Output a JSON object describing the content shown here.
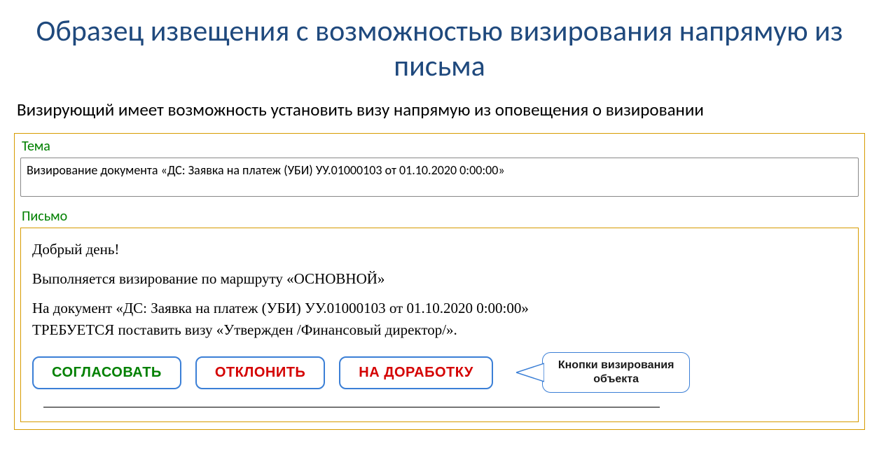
{
  "title": "Образец извещения с возможностью визирования напрямую из письма",
  "subtitle": "Визирующий имеет возможность установить визу напрямую из оповещения о визировании",
  "sections": {
    "subject_label": "Тема",
    "subject_text": "Визирование документа «ДС: Заявка на платеж (УБИ) УУ.01000103 от 01.10.2020 0:00:00»",
    "body_label": "Письмо"
  },
  "email": {
    "greeting": "Добрый день!",
    "route_line": "Выполняется визирование по маршруту «ОСНОВНОЙ»",
    "doc_line": "На документ «ДС: Заявка на платеж (УБИ) УУ.01000103 от 01.10.2020 0:00:00»",
    "action_line": "ТРЕБУЕТСЯ поставить визу «Утвержден /Финансовый директор/»."
  },
  "buttons": {
    "approve": "СОГЛАСОВАТЬ",
    "reject": "ОТКЛОНИТЬ",
    "rework": "НА ДОРАБОТКУ"
  },
  "callout": {
    "line1": "Кнопки визирования",
    "line2": "объекта"
  }
}
